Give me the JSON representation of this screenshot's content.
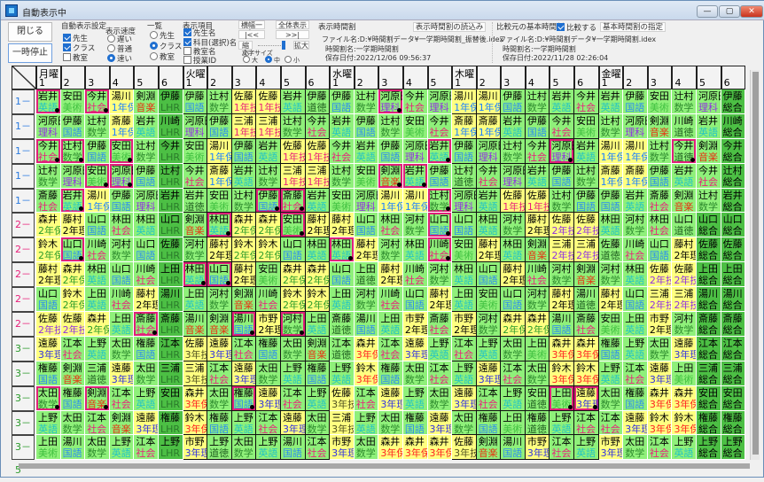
{
  "window": {
    "title": "自動表示中",
    "min": "—",
    "max": "▢",
    "close": "✕"
  },
  "controls": {
    "close_button": "閉じる",
    "pause_button": "一時停止",
    "auto_display": {
      "label": "自動表示設定",
      "options": [
        {
          "label": "先生",
          "checked": true
        },
        {
          "label": "クラス",
          "checked": true
        },
        {
          "label": "教室",
          "checked": false
        }
      ]
    },
    "speed": {
      "label": "表示速度",
      "options": [
        "遅い",
        "普通",
        "速い"
      ],
      "selected": "速い"
    },
    "list": {
      "label": "一覧",
      "options": [
        "先生",
        "クラス",
        "教室"
      ],
      "selected": "クラス"
    },
    "items": {
      "label": "表示項目",
      "options": [
        {
          "label": "先生名",
          "checked": true
        },
        {
          "label": "科目(選択)名",
          "checked": true
        },
        {
          "label": "教室名",
          "checked": false
        },
        {
          "label": "授業ID",
          "checked": false
        }
      ]
    },
    "fit_width": "横幅一杯",
    "show_all": "全体表示",
    "first": "|<<",
    "last": ">>|",
    "shrink": "縮小",
    "enlarge": "拡大",
    "zoom_level": 0.95,
    "font_size": {
      "label": "文字サイズ",
      "options": [
        "大",
        "中",
        "小"
      ],
      "selected": "中"
    }
  },
  "display_timetable": {
    "label": "表示時間割",
    "load_button": "表示時間割の読込み",
    "file": "ファイル名:D:¥時間割データ¥一学期時間割_振替後.idex",
    "name": "時間割名:一学期時間割",
    "saved": "保存日付:2022/12/06  09:56:37"
  },
  "compare_timetable": {
    "label": "比較元の基本時間割",
    "compare_label": "比較する",
    "compare_checked": true,
    "specify_button": "基本時間割の指定",
    "file": "ファイル名:D:¥時間割データ¥一学期時間割.idex",
    "name": "時間割名:一学期時間割",
    "saved": "保存日付:2022/11/28  02:26:04"
  },
  "subject_colors": {
    "国語": "#2a8cf0",
    "数学": "#2e8b2e",
    "英語": "#22c4c4",
    "社会": "#e8207a",
    "理科": "#9030e0",
    "美術": "#40c040",
    "音楽": "#e83010",
    "道徳": "#206020",
    "LHR": "#2a7a2a",
    "総合": "#000000",
    "1年保": "#1a7fff",
    "1年技": "#e8207a",
    "2年保": "#2a9a2a",
    "2年理": "#000000",
    "2年技": "#9030e0",
    "3年理": "#3030e0",
    "3年保": "#ff2020",
    "3年技": "#505020"
  },
  "label_colors": {
    "1": "#2a7ae0",
    "2": "#e8207a",
    "3": "#2a9a2a"
  },
  "days": [
    {
      "name": "月曜",
      "periods": [
        "1",
        "2",
        "3",
        "4",
        "5",
        "6"
      ],
      "dark": false
    },
    {
      "name": "火曜",
      "periods": [
        "1",
        "2",
        "3",
        "4",
        "5",
        "6"
      ],
      "dark": true
    },
    {
      "name": "水曜",
      "periods": [
        "1",
        "2",
        "3",
        "4",
        "5"
      ],
      "dark": false
    },
    {
      "name": "木曜",
      "periods": [
        "1",
        "2",
        "3",
        "4",
        "5",
        "6"
      ],
      "dark": true
    },
    {
      "name": "金曜",
      "periods": [
        "1",
        "2",
        "3",
        "4",
        "5",
        "6"
      ],
      "dark": false
    }
  ],
  "rows": [
    {
      "label": "1－1",
      "cells": [
        "岩井/英語/*",
        "安田/美術",
        "今井/社会/*",
        "湯川/1年保",
        "剣淵/音楽",
        "伊藤/LHR",
        "伊藤/国語",
        "辻村/数学",
        "佐藤/1年技",
        "佐藤/1年技",
        "岩井/英語",
        "伊藤/道徳",
        "伊藤/国語",
        "辻村/数学",
        "河原田/理科/*",
        "今井/社会",
        "河原田/理科",
        "湯川/1年保",
        "湯川/1年保",
        "伊藤/国語",
        "辻村/数学",
        "岩井/英語",
        "今井/社会",
        "岩井/英語",
        "伊藤/国語",
        "安田/美術",
        "辻村/数学",
        "河原田/理科",
        "伊藤/総合"
      ]
    },
    {
      "label": "1－2",
      "cells": [
        "河原田/理科",
        "伊藤/国語",
        "辻村/数学",
        "斎藤/1年保",
        "岩井/英語",
        "川崎/LHR",
        "河原田/理科",
        "伊藤/国語",
        "三浦/1年技",
        "三浦/1年技",
        "辻村/数学",
        "今井/社会",
        "岩井/英語",
        "伊藤/国語",
        "辻村/数学",
        "安田/美術",
        "今井/社会",
        "斎藤/1年保",
        "斎藤/1年保",
        "岩井/英語",
        "伊藤/国語",
        "今井/社会",
        "安田/美術",
        "辻村/数学",
        "河原田/理科",
        "剣淵/音楽",
        "川崎/道徳",
        "岩井/英語",
        "川崎/総合"
      ]
    },
    {
      "label": "1－3",
      "cells": [
        "今井/社会/*",
        "辻村/数学/*",
        "伊藤/国語",
        "安田/美術/*",
        "辻村/数学",
        "今井/LHR",
        "安田/美術",
        "湯川/1年保",
        "伊藤/国語",
        "岩井/英語",
        "佐藤/1年技",
        "佐藤/1年技",
        "今井/社会",
        "岩井/英語",
        "伊藤/国語",
        "河原田/理科",
        "岩井/英語/*",
        "伊藤/国語",
        "河原田/理科",
        "辻村/数学",
        "今井/社会",
        "河原田/理科/*",
        "岩井/英語",
        "湯川/1年保",
        "湯川/1年保",
        "辻村/数学",
        "今井/道徳/*",
        "剣淵/音楽",
        "今井/総合"
      ]
    },
    {
      "label": "1－4",
      "cells": [
        "辻村/数学",
        "河原田/理科",
        "安田/美術/*",
        "河原田/理科/*",
        "伊藤/国語",
        "辻村/LHR",
        "今井/社会",
        "斎藤/1年保",
        "岩井/英語",
        "辻村/数学",
        "三浦/1年技",
        "三浦/1年技",
        "辻村/数学",
        "安田/美術",
        "剣淵/音楽/*",
        "岩井/英語/*",
        "伊藤/国語",
        "辻村/道徳",
        "今井/社会",
        "河原田/理科",
        "岩井/英語",
        "伊藤/国語",
        "辻村/数学",
        "斎藤/1年保",
        "斎藤/1年保",
        "伊藤/国語",
        "岩井/英語",
        "今井/社会",
        "辻村/総合"
      ]
    },
    {
      "label": "1－5",
      "cells": [
        "斎藤/社会",
        "岩井/英語/*",
        "湯川/1年保",
        "伊藤/国語",
        "河原田/理科",
        "岩井/LHR",
        "岩井/道徳",
        "安田/美術",
        "辻村/数学",
        "伊藤/国語/*",
        "斎藤/社会/*",
        "岩井/英語",
        "安田/美術",
        "河原田/理科",
        "湯川/1年保",
        "湯川/1年保",
        "辻村/数学/*",
        "河原田/理科",
        "岩井/英語",
        "佐藤/1年技",
        "佐藤/1年技",
        "辻村/数学",
        "伊藤/国語",
        "伊藤/国語",
        "岩井/英語",
        "斎藤/社会",
        "剣淵/音楽",
        "辻村/数学",
        "岩井/総合"
      ]
    },
    {
      "label": "2－1",
      "cells": [
        "森井/2年保",
        "藤村/2年理",
        "山口/国語",
        "林田/社会",
        "林田/英語",
        "山口/LHR",
        "剣淵/音楽",
        "林田/英語/*",
        "森井/2年保",
        "森井/2年保",
        "安田/美術/*",
        "藤村/2年理",
        "藤村/2年理",
        "山口/国語",
        "林田/社会",
        "河村/数学",
        "山口/国語/*",
        "山口/国語",
        "林田/英語",
        "河村/数学",
        "藤村/2年理",
        "佐藤/2年技",
        "佐藤/2年技",
        "林田/英語",
        "河村/数学",
        "林田/社会",
        "山口/道徳",
        "山口/総合",
        "山口/総合"
      ]
    },
    {
      "label": "2－2",
      "cells": [
        "鈴木/2年保",
        "山口/国語/*",
        "川崎/社会",
        "河村/数学",
        "山口/国語",
        "佐藤/LHR",
        "河村/数学",
        "藤村/2年理",
        "鈴木/2年保",
        "鈴木/2年保",
        "山口/国語",
        "林田/英語",
        "林田/英語/*",
        "藤村/2年理",
        "河村/数学",
        "林田/英語",
        "川崎/社会/*",
        "安田/美術",
        "藤村/2年理",
        "林田/英語",
        "剣淵/音楽",
        "三浦/2年技",
        "三浦/2年技",
        "佐藤/道徳",
        "川崎/社会",
        "山口/国語",
        "藤村/2年理",
        "佐藤/総合",
        "佐藤/総合"
      ]
    },
    {
      "label": "2－3",
      "cells": [
        "藤村/2年理",
        "森井/2年保",
        "林田/英語",
        "山口/国語",
        "川崎/社会",
        "上田/LHR",
        "林田/英語/*",
        "山口/国語/*",
        "藤村/2年理",
        "安田/美術",
        "森井/2年保",
        "森井/2年保",
        "山口/国語",
        "上田/道徳",
        "藤村/2年理",
        "川崎/社会",
        "河村/数学",
        "林田/英語",
        "山口/国語",
        "藤村/2年理",
        "川崎/社会",
        "河村/数学",
        "剣淵/音楽",
        "河村/数学",
        "林田/英語",
        "佐藤/2年技",
        "佐藤/2年技",
        "上田/総合",
        "上田/総合"
      ]
    },
    {
      "label": "2－4",
      "cells": [
        "山口/国語",
        "鈴木/2年保",
        "上田/英語",
        "川崎/社会",
        "藤村/2年理",
        "湯川/LHR",
        "上田/英語",
        "河村/数学",
        "剣淵/音楽",
        "川崎/社会",
        "鈴木/2年保",
        "鈴木/2年保",
        "上田/英語",
        "河村/数学",
        "川崎/社会",
        "山口/国語",
        "藤村/2年理",
        "上田/英語",
        "安田/美術",
        "山口/国語",
        "河村/数学",
        "藤村/2年理",
        "湯川/道徳",
        "藤村/2年理",
        "山口/国語",
        "三浦/2年技",
        "三浦/2年技",
        "湯川/総合",
        "湯川/総合"
      ]
    },
    {
      "label": "2－5",
      "cells": [
        "佐藤/2年技",
        "佐藤/2年技",
        "森井/2年保",
        "上田/英語",
        "斎藤/社会/*",
        "斎藤/LHR",
        "湯川/音楽",
        "剣淵/音楽",
        "湯川/国語/*",
        "市野/2年理",
        "河村/数学/*",
        "上田/英語",
        "斎藤/道徳",
        "湯川/国語",
        "上田/英語",
        "市野/2年理",
        "斎藤/社会",
        "市野/2年理",
        "河村/数学",
        "森井/2年保",
        "森井/2年保",
        "湯川/国語",
        "斎藤/社会",
        "安田/美術",
        "上田/英語",
        "市野/2年理",
        "河村/数学",
        "斎藤/総合",
        "斎藤/総合"
      ]
    },
    {
      "label": "3－1",
      "cells": [
        "遠藤/3年理",
        "江本/社会",
        "上野/英語",
        "太田/数学",
        "権藤/国語",
        "江本/LHR",
        "佐藤/3年技",
        "遠藤/3年理",
        "江本/社会",
        "権藤/国語",
        "太田/数学",
        "剣淵/音楽",
        "江本/道徳",
        "森井/3年保",
        "江本/社会",
        "遠藤/3年理",
        "上野/英語",
        "江本/社会",
        "上野/英語",
        "太田/数学",
        "上田/美術",
        "森井/3年保",
        "森井/3年保",
        "権藤/国語",
        "上野/英語",
        "太田/数学",
        "遠藤/3年理",
        "江本/総合",
        "江本/総合"
      ]
    },
    {
      "label": "3－2",
      "cells": [
        "権藤/国語",
        "剣淵/音楽",
        "三浦/道徳",
        "遠藤/3年理",
        "太田/数学",
        "三浦/LHR",
        "三浦/3年技",
        "江本/社会",
        "遠藤/3年理",
        "太田/数学",
        "上野/英語",
        "権藤/国語",
        "上野/英語",
        "鈴木/3年保",
        "権藤/国語",
        "太田/数学",
        "江本/社会",
        "上野/英語",
        "遠藤/3年理",
        "江本/社会",
        "太田/数学",
        "鈴木/3年保",
        "鈴木/3年保",
        "上野/英語",
        "江本/社会",
        "遠藤/3年理",
        "上田/美術",
        "三浦/総合",
        "三浦/総合"
      ]
    },
    {
      "label": "3－3",
      "cells": [
        "太田/数学/*",
        "権藤/国語",
        "剣淵/音楽/*",
        "江本/社会",
        "上野/英語",
        "安田/LHR",
        "森井/3年保",
        "太田/数学",
        "権藤/国語/*",
        "遠藤/3年理",
        "江本/社会",
        "上野/英語",
        "佐藤/3年技",
        "江本/社会",
        "遠藤/3年理",
        "上野/英語",
        "太田/数学",
        "遠藤/3年理",
        "江本/社会",
        "上野/英語",
        "安田/道徳",
        "上田/美術/*",
        "遠藤/3年理/*",
        "太田/数学",
        "権藤/国語",
        "森井/3年保",
        "森井/3年保",
        "安田/総合",
        "安田/総合"
      ]
    },
    {
      "label": "3－4",
      "cells": [
        "上野/英語",
        "太田/数学",
        "江本/社会",
        "剣淵/音楽",
        "遠藤/3年理",
        "権藤/LHR",
        "鈴木/3年保",
        "権藤/国語",
        "上野/英語",
        "江本/社会",
        "遠藤/3年理",
        "太田/数学",
        "三浦/3年技",
        "上野/英語",
        "太田/数学",
        "権藤/国語",
        "遠藤/3年理",
        "太田/数学",
        "権藤/国語",
        "上田/美術",
        "権藤/道徳",
        "上野/英語",
        "江本/社会",
        "江本/社会",
        "遠藤/3年理",
        "鈴木/3年保",
        "鈴木/3年保",
        "権藤/総合",
        "権藤/総合"
      ]
    },
    {
      "label": "3－5",
      "cells": [
        "上田/美術",
        "湯川/国語",
        "太田/数学",
        "上野/英語",
        "江本/社会",
        "上野/LHR",
        "市野/3年理",
        "上野/道徳",
        "太田/数学",
        "上野/英語",
        "湯川/国語",
        "江本/社会",
        "市野/3年理",
        "太田/数学",
        "森井/3年保",
        "森井/3年保",
        "森井/3年保",
        "佐藤/3年技",
        "剣淵/音楽",
        "湯川/国語",
        "市野/3年理",
        "江本/社会",
        "上野/英語",
        "市野/3年理",
        "太田/数学",
        "江本/社会",
        "上野/英語",
        "上野/総合",
        "上野/総合"
      ]
    }
  ]
}
